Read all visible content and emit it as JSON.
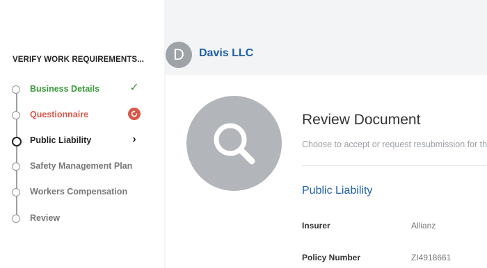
{
  "sidebar": {
    "title": "VERIFY WORK REQUIREMENTS...",
    "steps": [
      {
        "label": "Business Details",
        "status": "done"
      },
      {
        "label": "Questionnaire",
        "status": "resubmit"
      },
      {
        "label": "Public Liability",
        "status": "current"
      },
      {
        "label": "Safety Management Plan",
        "status": "pending"
      },
      {
        "label": "Workers Compensation",
        "status": "pending"
      },
      {
        "label": "Review",
        "status": "pending"
      }
    ],
    "check_glyph": "✓",
    "chevron_glyph": "›"
  },
  "header": {
    "avatar_initial": "D",
    "company_name": "Davis LLC"
  },
  "main": {
    "document_icon": "search-icon",
    "title": "Review Document",
    "subtitle": "Choose to accept or request resubmission for th",
    "section_title": "Public Liability",
    "fields": [
      {
        "label": "Insurer",
        "value": "Allianz"
      },
      {
        "label": "Policy Number",
        "value": "ZI4918661"
      }
    ]
  },
  "colors": {
    "accent_blue": "#1f5fa8",
    "success_green": "#3a9a3a",
    "warning_red": "#d9584a",
    "avatar_gray": "#9ea3a8"
  }
}
